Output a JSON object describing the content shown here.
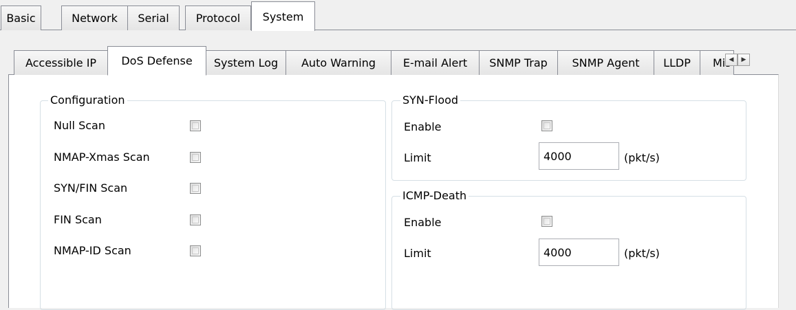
{
  "top_tabs": [
    "Basic",
    "Network",
    "Serial",
    "Protocol",
    "System"
  ],
  "active_top_tab": "System",
  "sub_tabs": [
    "Accessible IP",
    "DoS Defense",
    "System Log",
    "Auto Warning",
    "E-mail Alert",
    "SNMP Trap",
    "SNMP Agent",
    "LLDP",
    "Mis"
  ],
  "active_sub_tab": "DoS Defense",
  "scroll_left_glyph": "◀",
  "scroll_right_glyph": "▶",
  "configuration": {
    "title": "Configuration",
    "items": [
      "Null Scan",
      "NMAP-Xmas Scan",
      "SYN/FIN Scan",
      "FIN Scan",
      "NMAP-ID Scan"
    ]
  },
  "syn_flood": {
    "title": "SYN-Flood",
    "enable_label": "Enable",
    "limit_label": "Limit",
    "limit_value": "4000",
    "unit": "(pkt/s)"
  },
  "icmp_death": {
    "title": "ICMP-Death",
    "enable_label": "Enable",
    "limit_label": "Limit",
    "limit_value": "4000",
    "unit": "(pkt/s)"
  }
}
